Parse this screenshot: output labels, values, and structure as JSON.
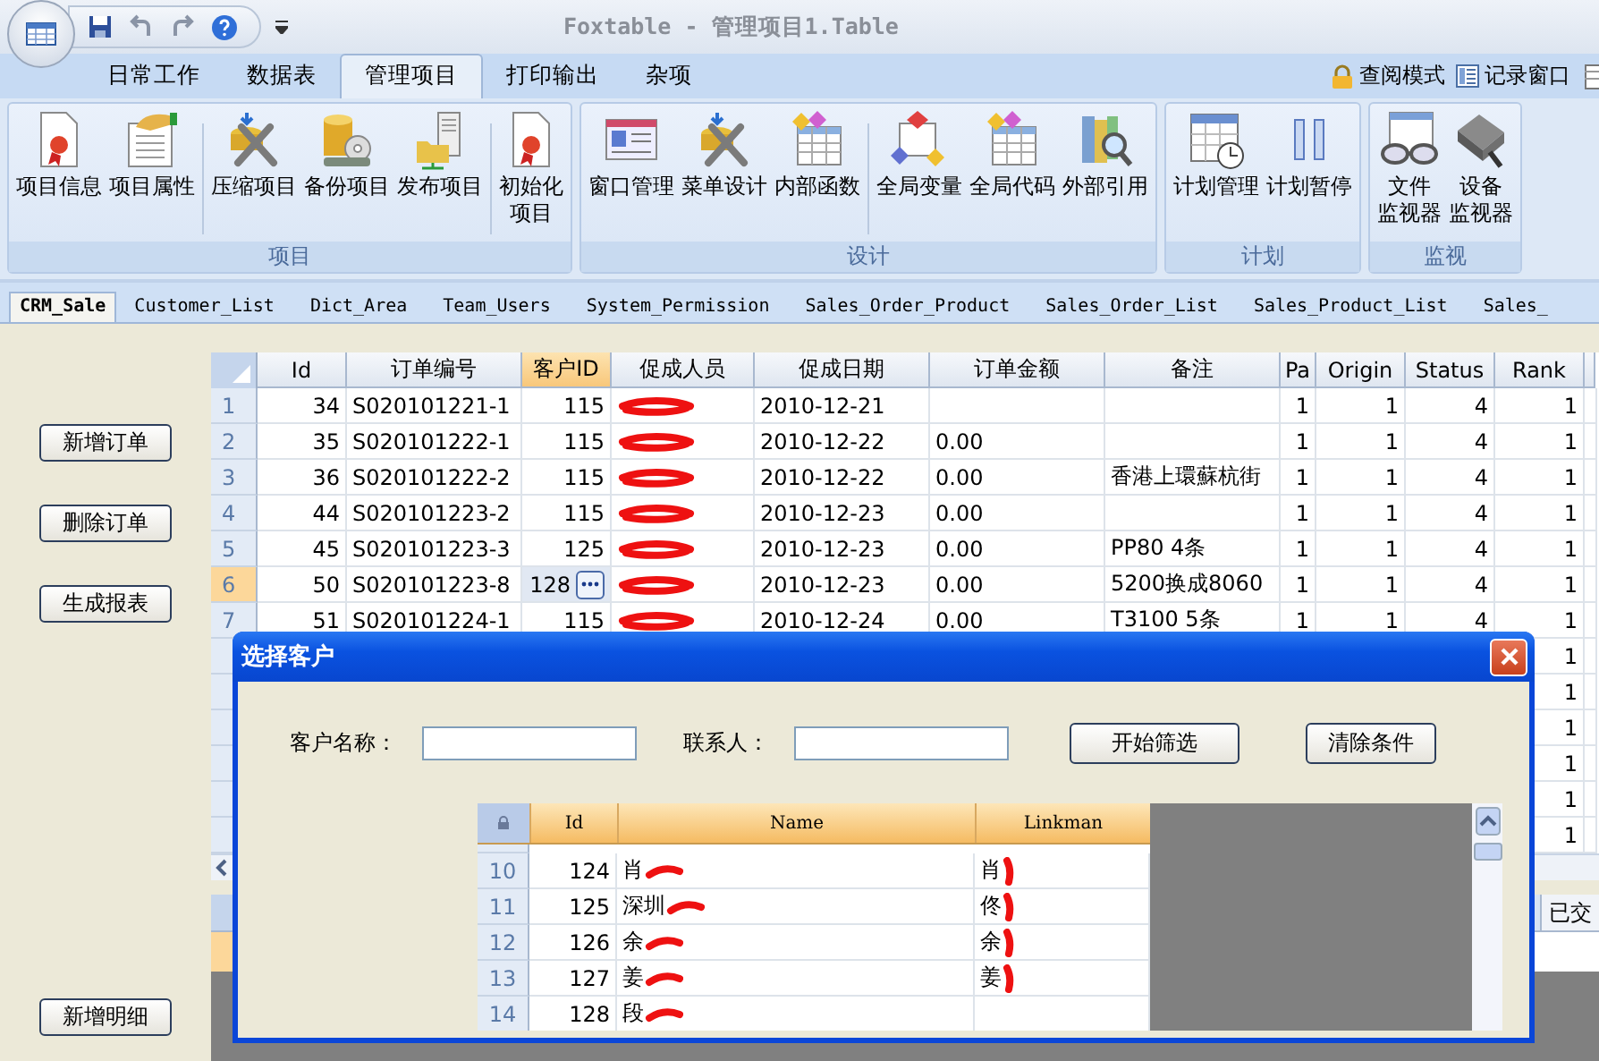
{
  "window": {
    "title": "Foxtable - 管理项目1.Table"
  },
  "ribbon": {
    "tabs": [
      {
        "label": "日常工作",
        "selected": false
      },
      {
        "label": "数据表",
        "selected": false
      },
      {
        "label": "管理项目",
        "selected": true
      },
      {
        "label": "打印输出",
        "selected": false
      },
      {
        "label": "杂项",
        "selected": false
      }
    ],
    "right_items": [
      "查阅模式",
      "记录窗口"
    ],
    "groups": [
      {
        "label": "项目",
        "sets": [
          [
            {
              "lines": [
                "项目信息"
              ]
            },
            {
              "lines": [
                "项目属性"
              ]
            }
          ],
          [
            {
              "lines": [
                "压缩项目"
              ]
            },
            {
              "lines": [
                "备份项目"
              ]
            },
            {
              "lines": [
                "发布项目"
              ]
            }
          ],
          [
            {
              "lines": [
                "初始化",
                "项目"
              ]
            }
          ]
        ]
      },
      {
        "label": "设计",
        "sets": [
          [
            {
              "lines": [
                "窗口管理"
              ]
            },
            {
              "lines": [
                "菜单设计"
              ]
            },
            {
              "lines": [
                "内部函数"
              ]
            }
          ],
          [
            {
              "lines": [
                "全局变量"
              ]
            },
            {
              "lines": [
                "全局代码"
              ]
            },
            {
              "lines": [
                "外部引用"
              ]
            }
          ]
        ]
      },
      {
        "label": "计划",
        "sets": [
          [
            {
              "lines": [
                "计划管理"
              ]
            },
            {
              "lines": [
                "计划暂停"
              ]
            }
          ]
        ]
      },
      {
        "label": "监视",
        "sets": [
          [
            {
              "lines": [
                "文件",
                "监视器"
              ]
            },
            {
              "lines": [
                "设备",
                "监视器"
              ]
            }
          ]
        ]
      }
    ]
  },
  "table_tabs": [
    {
      "label": "CRM_Sale",
      "selected": true
    },
    {
      "label": "Customer_List",
      "selected": false
    },
    {
      "label": "Dict_Area",
      "selected": false
    },
    {
      "label": "Team_Users",
      "selected": false
    },
    {
      "label": "System_Permission",
      "selected": false
    },
    {
      "label": "Sales_Order_Product",
      "selected": false
    },
    {
      "label": "Sales_Order_List",
      "selected": false
    },
    {
      "label": "Sales_Product_List",
      "selected": false
    },
    {
      "label": "Sales_",
      "selected": false
    }
  ],
  "side_buttons": [
    "新增订单",
    "删除订单",
    "生成报表",
    "新增明细"
  ],
  "table": {
    "columns": [
      {
        "label": "Id",
        "selected": false
      },
      {
        "label": "订单编号",
        "selected": false
      },
      {
        "label": "客户ID",
        "selected": true
      },
      {
        "label": "促成人员",
        "selected": false
      },
      {
        "label": "促成日期",
        "selected": false
      },
      {
        "label": "订单金额",
        "selected": false
      },
      {
        "label": "备注",
        "selected": false
      },
      {
        "label": "Pa",
        "selected": false
      },
      {
        "label": "Origin",
        "selected": false
      },
      {
        "label": "Status",
        "selected": false
      },
      {
        "label": "Rank",
        "selected": false
      }
    ],
    "rows": [
      {
        "n": "1",
        "id": "34",
        "order_no": "S020101221-1",
        "customer_id": "115",
        "redacted": true,
        "date": "2010-12-21",
        "pa": "1",
        "origin": "1",
        "status": "4",
        "rank": "1",
        "selected": false
      },
      {
        "n": "2",
        "id": "35",
        "order_no": "S020101222-1",
        "customer_id": "115",
        "redacted": true,
        "date": "2010-12-22",
        "amount": "0.00",
        "pa": "1",
        "origin": "1",
        "status": "4",
        "rank": "1",
        "selected": false
      },
      {
        "n": "3",
        "id": "36",
        "order_no": "S020101222-2",
        "customer_id": "115",
        "redacted": true,
        "date": "2010-12-22",
        "amount": "0.00",
        "note": "香港上環蘇杭街",
        "pa": "1",
        "origin": "1",
        "status": "4",
        "rank": "1",
        "selected": false
      },
      {
        "n": "4",
        "id": "44",
        "order_no": "S020101223-2",
        "customer_id": "115",
        "redacted": true,
        "date": "2010-12-23",
        "amount": "0.00",
        "pa": "1",
        "origin": "1",
        "status": "4",
        "rank": "1",
        "selected": false
      },
      {
        "n": "5",
        "id": "45",
        "order_no": "S020101223-3",
        "customer_id": "125",
        "redacted": true,
        "date": "2010-12-23",
        "amount": "0.00",
        "note": "PP80 4条",
        "pa": "1",
        "origin": "1",
        "status": "4",
        "rank": "1",
        "selected": false
      },
      {
        "n": "6",
        "id": "50",
        "order_no": "S020101223-8",
        "customer_id": "128",
        "redacted": true,
        "date": "2010-12-23",
        "amount": "0.00",
        "note": "5200换成8060",
        "pa": "1",
        "origin": "1",
        "status": "4",
        "rank": "1",
        "selected": true
      },
      {
        "n": "7",
        "id": "51",
        "order_no": "S020101224-1",
        "customer_id": "115",
        "redacted": true,
        "date": "2010-12-24",
        "amount": "0.00",
        "note": "T3100 5条",
        "pa": "1",
        "origin": "1",
        "status": "4",
        "rank": "1",
        "selected": false
      },
      {
        "rank": "1",
        "selected": false
      },
      {
        "rank": "1",
        "selected": false
      },
      {
        "rank": "1",
        "selected": false
      },
      {
        "rank": "1",
        "selected": false
      },
      {
        "rank": "1",
        "selected": false
      },
      {
        "rank": "1",
        "selected": false
      }
    ]
  },
  "detail_table": {
    "column_headers": [
      "已交"
    ]
  },
  "dialog": {
    "title": "选择客户",
    "fields": [
      {
        "label": "客户名称："
      },
      {
        "label": "联系人："
      }
    ],
    "buttons": [
      "开始筛选",
      "清除条件"
    ],
    "grid": {
      "columns": [
        "Id",
        "Name",
        "Linkman"
      ],
      "rows": [
        {
          "n": "10",
          "id": "124",
          "name": "肖",
          "linkman": "肖",
          "redacted": true
        },
        {
          "n": "11",
          "id": "125",
          "name": "深圳",
          "linkman": "佟",
          "redacted": true
        },
        {
          "n": "12",
          "id": "126",
          "name": "余",
          "linkman": "余",
          "redacted": true
        },
        {
          "n": "13",
          "id": "127",
          "name": "姜",
          "linkman": "姜",
          "redacted": true
        },
        {
          "n": "14",
          "id": "128",
          "name": "段",
          "redacted": true
        }
      ]
    }
  }
}
